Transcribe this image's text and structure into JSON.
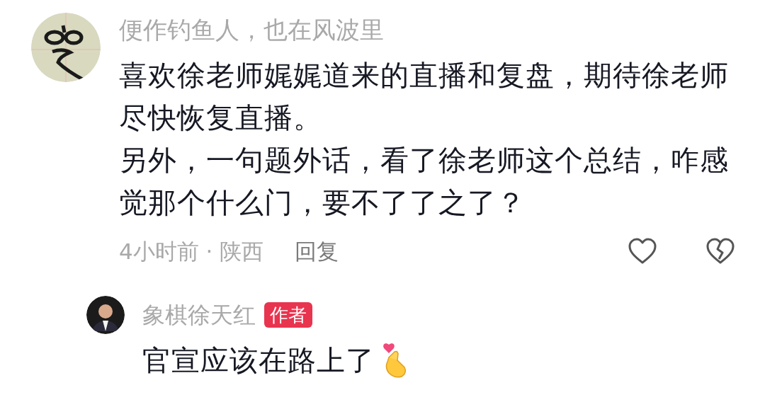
{
  "comment": {
    "author": "便作钓鱼人，也在风波里",
    "paragraphs": [
      "喜欢徐老师娓娓道来的直播和复盘，期待徐老师尽快恢复直播。",
      "另外，一句题外话，看了徐老师这个总结，咋感觉那个什么门，要不了了之了？"
    ],
    "time": "4小时前",
    "separator": "·",
    "location": "陕西",
    "reply_label": "回复",
    "liked": false,
    "disliked": false,
    "replies": [
      {
        "author": "象棋徐天红",
        "badge": "作者",
        "text": "官宣应该在路上了"
      }
    ]
  }
}
